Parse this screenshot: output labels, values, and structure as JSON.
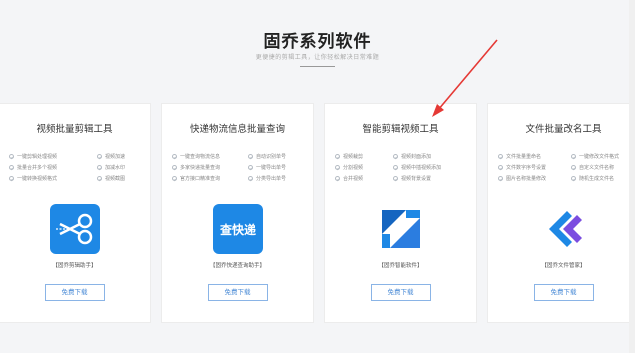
{
  "header": {
    "title": "固乔系列软件",
    "subtitle": "更便捷的剪辑工具，让你轻松解决日常难题"
  },
  "cards": [
    {
      "title": "视频批量剪辑工具",
      "features_left": [
        "一键剪辑处理视频",
        "批量合并多个视频",
        "一键转换视频格式"
      ],
      "features_right": [
        "视频加速",
        "加减水印",
        "视频截图"
      ],
      "caption": "【固乔剪辑助手】",
      "button": "免费下载",
      "icon": "scissors-icon",
      "color": "#1e88e5"
    },
    {
      "title": "快递物流信息批量查询",
      "features_left": [
        "一键查询物流信息",
        "多家快递批量查询",
        "官方接口精准查询"
      ],
      "features_right": [
        "自动识别单号",
        "一键导出单号",
        "分类导出单号"
      ],
      "caption": "【固乔快递查询助手】",
      "button": "免费下载",
      "icon": "express-icon",
      "logo_text": "查快递",
      "color": "#1e88e5"
    },
    {
      "title": "智能剪辑视频工具",
      "features_left": [
        "视频裁剪",
        "分割视频",
        "合并视频"
      ],
      "features_right": [
        "视频封面添加",
        "视频中插视频添加",
        "视频背景设置"
      ],
      "caption": "【固乔智能软件】",
      "button": "免费下载",
      "icon": "crop-icon",
      "color": "#2b7de0"
    },
    {
      "title": "文件批量改名工具",
      "features_left": [
        "文件批量重命名",
        "文件数字序号设置",
        "图片名称批量修改"
      ],
      "features_right": [
        "一键修改文件格式",
        "自定义文件名称",
        "随机生成文件名"
      ],
      "caption": "【固乔文件管家】",
      "button": "免费下载",
      "icon": "rename-icon",
      "color": "#2b6fde"
    }
  ]
}
